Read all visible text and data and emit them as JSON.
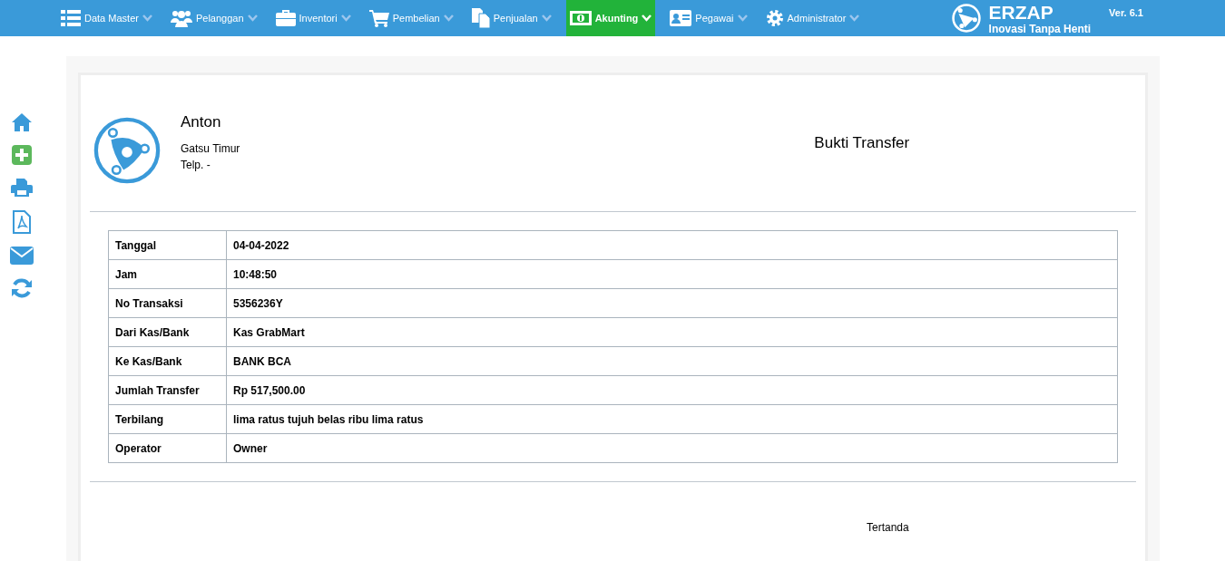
{
  "nav": {
    "items": [
      {
        "label": "Data Master",
        "selected": false
      },
      {
        "label": "Pelanggan",
        "selected": false
      },
      {
        "label": "Inventori",
        "selected": false
      },
      {
        "label": "Pembelian",
        "selected": false
      },
      {
        "label": "Penjualan",
        "selected": false
      },
      {
        "label": "Akunting",
        "selected": true
      },
      {
        "label": "Pegawai",
        "selected": false
      },
      {
        "label": "Administrator",
        "selected": false
      }
    ],
    "brand": {
      "name": "ERZAP",
      "tagline": "Inovasi Tanpa Henti",
      "version": "Ver. 6.1"
    }
  },
  "document": {
    "company": "Anton",
    "address": "Gatsu Timur",
    "phone": "Telp. -",
    "title": "Bukti Transfer",
    "rows": [
      {
        "label": "Tanggal",
        "value": "04-04-2022"
      },
      {
        "label": "Jam",
        "value": "10:48:50"
      },
      {
        "label": "No Transaksi",
        "value": "5356236Y"
      },
      {
        "label": "Dari Kas/Bank",
        "value": "Kas GrabMart"
      },
      {
        "label": "Ke Kas/Bank",
        "value": "BANK BCA"
      },
      {
        "label": "Jumlah Transfer",
        "value": "Rp 517,500.00"
      },
      {
        "label": "Terbilang",
        "value": "lima ratus tujuh belas ribu lima ratus"
      },
      {
        "label": "Operator",
        "value": "Owner"
      }
    ],
    "signature": "Tertanda"
  }
}
